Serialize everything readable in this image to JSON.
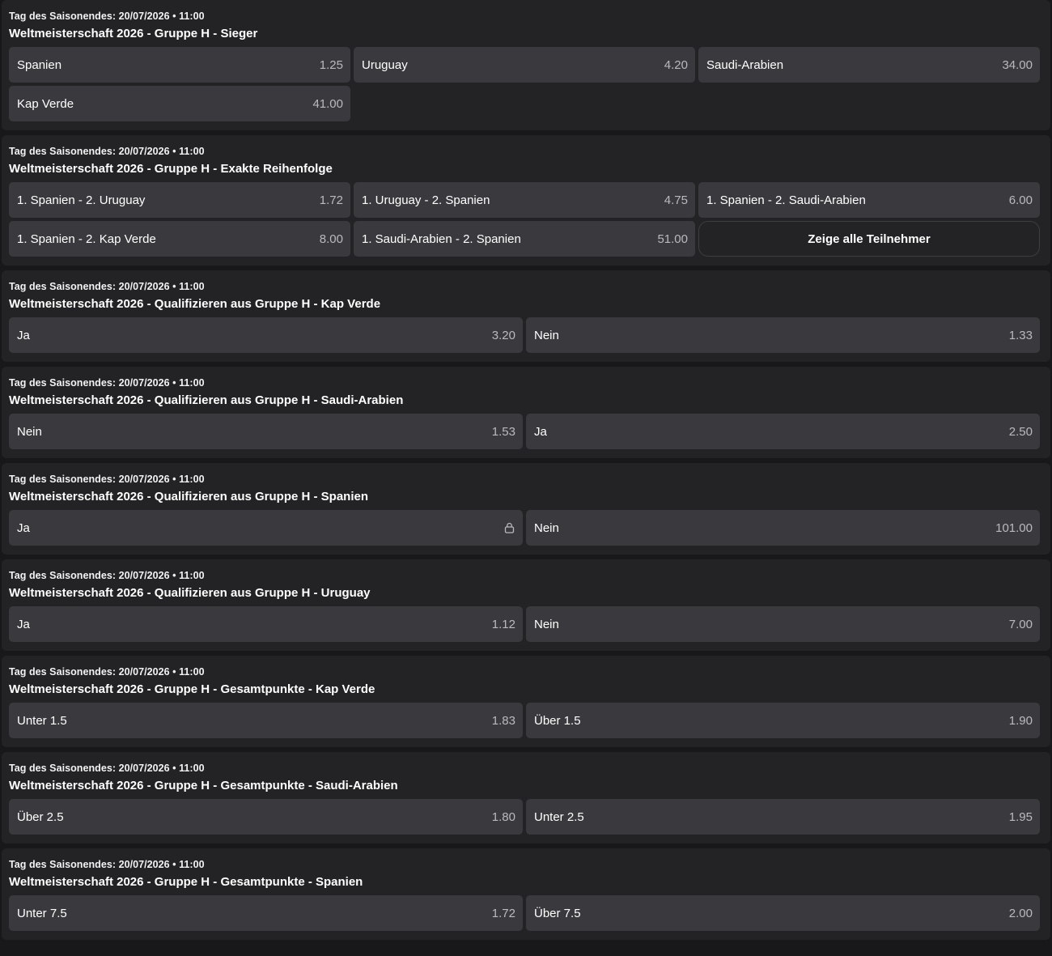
{
  "markets": [
    {
      "date": "Tag des Saisonendes: 20/07/2026 • 11:00",
      "title": "Weltmeisterschaft 2026 - Gruppe H - Sieger",
      "columns": 3,
      "outcomes": [
        {
          "label": "Spanien",
          "odds": "1.25"
        },
        {
          "label": "Uruguay",
          "odds": "4.20"
        },
        {
          "label": "Saudi-Arabien",
          "odds": "34.00"
        },
        {
          "label": "Kap Verde",
          "odds": "41.00"
        }
      ]
    },
    {
      "date": "Tag des Saisonendes: 20/07/2026 • 11:00",
      "title": "Weltmeisterschaft 2026 - Gruppe H - Exakte Reihenfolge",
      "columns": 3,
      "outcomes": [
        {
          "label": "1. Spanien - 2. Uruguay",
          "odds": "1.72"
        },
        {
          "label": "1. Uruguay - 2. Spanien",
          "odds": "4.75"
        },
        {
          "label": "1. Spanien - 2. Saudi-Arabien",
          "odds": "6.00"
        },
        {
          "label": "1. Spanien - 2. Kap Verde",
          "odds": "8.00"
        },
        {
          "label": "1. Saudi-Arabien - 2. Spanien",
          "odds": "51.00"
        }
      ],
      "show_all_label": "Zeige alle Teilnehmer"
    },
    {
      "date": "Tag des Saisonendes: 20/07/2026 • 11:00",
      "title": "Weltmeisterschaft 2026 - Qualifizieren aus Gruppe H - Kap Verde",
      "columns": 2,
      "outcomes": [
        {
          "label": "Ja",
          "odds": "3.20"
        },
        {
          "label": "Nein",
          "odds": "1.33"
        }
      ]
    },
    {
      "date": "Tag des Saisonendes: 20/07/2026 • 11:00",
      "title": "Weltmeisterschaft 2026 - Qualifizieren aus Gruppe H - Saudi-Arabien",
      "columns": 2,
      "outcomes": [
        {
          "label": "Nein",
          "odds": "1.53"
        },
        {
          "label": "Ja",
          "odds": "2.50"
        }
      ]
    },
    {
      "date": "Tag des Saisonendes: 20/07/2026 • 11:00",
      "title": "Weltmeisterschaft 2026 - Qualifizieren aus Gruppe H - Spanien",
      "columns": 2,
      "outcomes": [
        {
          "label": "Ja",
          "odds": "",
          "locked": true,
          "icon": "lock-icon"
        },
        {
          "label": "Nein",
          "odds": "101.00"
        }
      ]
    },
    {
      "date": "Tag des Saisonendes: 20/07/2026 • 11:00",
      "title": "Weltmeisterschaft 2026 - Qualifizieren aus Gruppe H - Uruguay",
      "columns": 2,
      "outcomes": [
        {
          "label": "Ja",
          "odds": "1.12"
        },
        {
          "label": "Nein",
          "odds": "7.00"
        }
      ]
    },
    {
      "date": "Tag des Saisonendes: 20/07/2026 • 11:00",
      "title": "Weltmeisterschaft 2026 - Gruppe H - Gesamtpunkte - Kap Verde",
      "columns": 2,
      "outcomes": [
        {
          "label": "Unter 1.5",
          "odds": "1.83"
        },
        {
          "label": "Über 1.5",
          "odds": "1.90"
        }
      ]
    },
    {
      "date": "Tag des Saisonendes: 20/07/2026 • 11:00",
      "title": "Weltmeisterschaft 2026 - Gruppe H - Gesamtpunkte - Saudi-Arabien",
      "columns": 2,
      "outcomes": [
        {
          "label": "Über 2.5",
          "odds": "1.80"
        },
        {
          "label": "Unter 2.5",
          "odds": "1.95"
        }
      ]
    },
    {
      "date": "Tag des Saisonendes: 20/07/2026 • 11:00",
      "title": "Weltmeisterschaft 2026 - Gruppe H - Gesamtpunkte - Spanien",
      "columns": 2,
      "outcomes": [
        {
          "label": "Unter 7.5",
          "odds": "1.72"
        },
        {
          "label": "Über 7.5",
          "odds": "2.00"
        }
      ]
    }
  ],
  "colors": {
    "page_bg": "#18181b",
    "card_bg": "#232326",
    "button_bg": "#3a3a3e",
    "odds_text": "#b9b9bf",
    "outline": "#3d3d42"
  }
}
